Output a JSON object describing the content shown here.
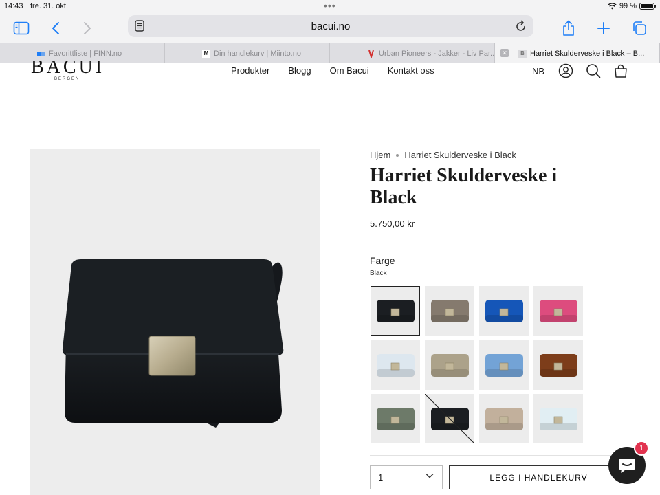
{
  "status_bar": {
    "time": "14:43",
    "date": "fre. 31. okt.",
    "battery": "99 %"
  },
  "browser": {
    "url": "bacui.no",
    "accent_color": "#1e7ef7",
    "tabs": [
      {
        "label": "Favorittliste | FINN.no",
        "icon": "finn-favicon"
      },
      {
        "label": "Din handlekurv | Miinto.no",
        "icon": "miinto-favicon",
        "favicon_text": "M"
      },
      {
        "label": "Urban Pioneers - Jakker - Liv Par...",
        "icon": "urban-pioneers-favicon"
      },
      {
        "label": "Harriet Skulderveske i Black – B...",
        "icon": "bacui-favicon",
        "favicon_text": "B",
        "active": true
      }
    ]
  },
  "site": {
    "logo": "BACUI",
    "logo_sub": "BERGEN",
    "nav": [
      "Produkter",
      "Blogg",
      "Om Bacui",
      "Kontakt oss"
    ],
    "language": "NB"
  },
  "product": {
    "breadcrumb": [
      "Hjem",
      "Harriet Skulderveske i Black"
    ],
    "title": "Harriet Skulderveske i Black",
    "price": "5.750,00 kr",
    "option_label": "Farge",
    "selected_color": "Black",
    "swatches": [
      {
        "color": "#1b1e22",
        "selected": true,
        "available": true
      },
      {
        "color": "#857a6e",
        "available": true
      },
      {
        "color": "#1556b8",
        "available": true
      },
      {
        "color": "#dd4c7e",
        "available": true
      },
      {
        "color": "#dde7ef",
        "available": true
      },
      {
        "color": "#aca28a",
        "available": true
      },
      {
        "color": "#73a3d6",
        "available": true
      },
      {
        "color": "#7d3d1a",
        "available": true
      },
      {
        "color": "#6d7a69",
        "available": true
      },
      {
        "color": "#1b1e22",
        "available": false
      },
      {
        "color": "#c2b09c",
        "available": true
      },
      {
        "color": "#e1eef3",
        "available": true
      }
    ],
    "quantity": "1",
    "add_to_cart": "LEGG I HANDLEKURV"
  },
  "chat": {
    "badge_count": "1"
  }
}
